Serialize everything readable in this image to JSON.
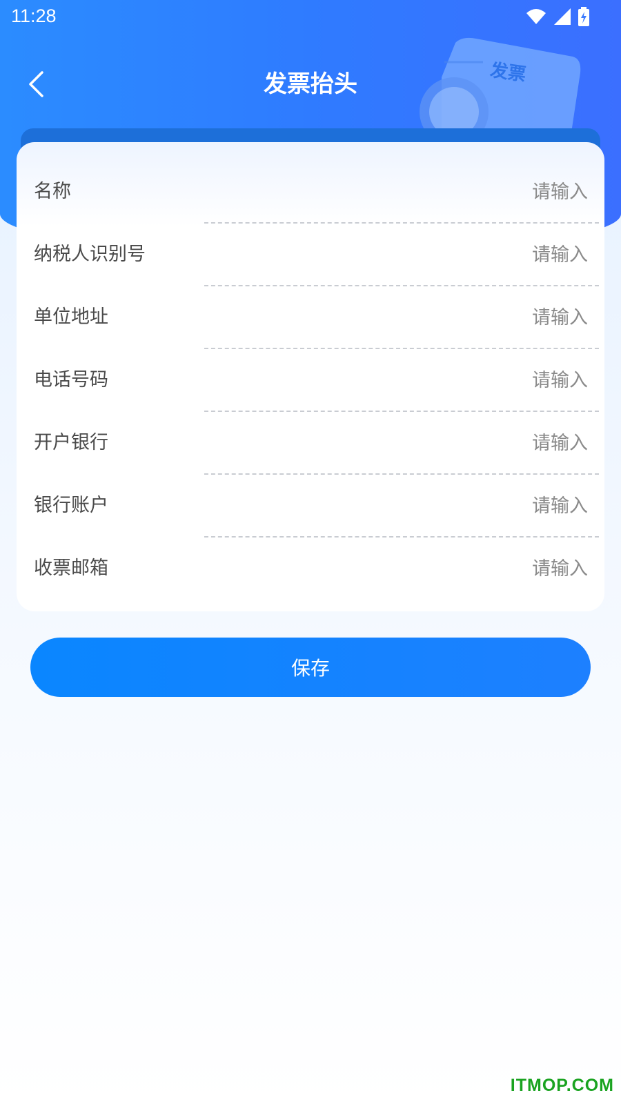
{
  "status_bar": {
    "time": "11:28",
    "icons": [
      "wifi-icon",
      "cell-signal-icon",
      "battery-charging-icon"
    ]
  },
  "header": {
    "title": "发票抬头",
    "back_icon": "chevron-left-icon",
    "decor_label": "发票"
  },
  "form": {
    "fields": [
      {
        "label": "名称",
        "placeholder": "请输入",
        "value": ""
      },
      {
        "label": "纳税人识别号",
        "placeholder": "请输入",
        "value": ""
      },
      {
        "label": "单位地址",
        "placeholder": "请输入",
        "value": ""
      },
      {
        "label": "电话号码",
        "placeholder": "请输入",
        "value": ""
      },
      {
        "label": "开户银行",
        "placeholder": "请输入",
        "value": ""
      },
      {
        "label": "银行账户",
        "placeholder": "请输入",
        "value": ""
      },
      {
        "label": "收票邮箱",
        "placeholder": "请输入",
        "value": ""
      }
    ]
  },
  "actions": {
    "save_label": "保存"
  },
  "watermark": "ITMOP.COM",
  "colors": {
    "header_blue": "#2f7bff",
    "button_blue": "#0a86ff",
    "watermark_green": "#1aa320"
  }
}
